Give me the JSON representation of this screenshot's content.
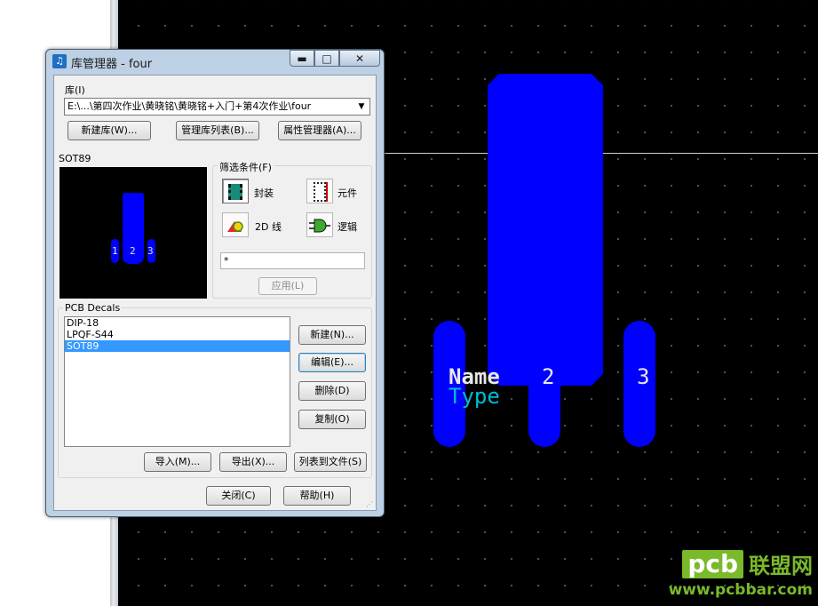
{
  "window": {
    "title": "库管理器 - four",
    "minimize": "▬",
    "maximize": "□",
    "close": "✕"
  },
  "library": {
    "label": "库(I)",
    "path": "E:\\...\\第四次作业\\黄晓铭\\黄晓铭+入门+第4次作业\\four",
    "buttons": [
      "新建库(W)...",
      "管理库列表(B)...",
      "属性管理器(A)..."
    ]
  },
  "preview": {
    "label": "SOT89",
    "pins": [
      "1",
      "2",
      "3"
    ]
  },
  "filter": {
    "label": "筛选条件(F)",
    "options": [
      {
        "label": "封装",
        "icon": "decal-icon",
        "active": true
      },
      {
        "label": "元件",
        "icon": "part-icon",
        "active": false
      },
      {
        "label": "2D 线",
        "icon": "2d-line-icon",
        "active": false
      },
      {
        "label": "逻辑",
        "icon": "logic-icon",
        "active": false
      }
    ],
    "text": "*",
    "apply": "应用(L)"
  },
  "decals": {
    "label": "PCB Decals",
    "items": [
      "DIP-18",
      "LPQF-S44",
      "SOT89"
    ],
    "selected": "SOT89",
    "buttons": [
      "新建(N)...",
      "编辑(E)...",
      "删除(D)",
      "复制(O)"
    ]
  },
  "bottom": {
    "buttons": [
      "导入(M)...",
      "导出(X)...",
      "列表到文件(S)"
    ],
    "close": "关闭(C)",
    "help": "帮助(H)"
  },
  "editor": {
    "pin_labels": [
      "2",
      "3"
    ],
    "name_label": "Name",
    "type_label": "Type"
  },
  "watermark": {
    "brand": "pcb",
    "cn": "联盟网",
    "url": "www.pcbbar.com"
  },
  "colors": {
    "pad": "#0000ff",
    "canvas": "#000000",
    "name_text": "#e8e8e8",
    "type_text": "#00bcd4",
    "selection": "#3399ff",
    "watermark": "#7ab929"
  }
}
